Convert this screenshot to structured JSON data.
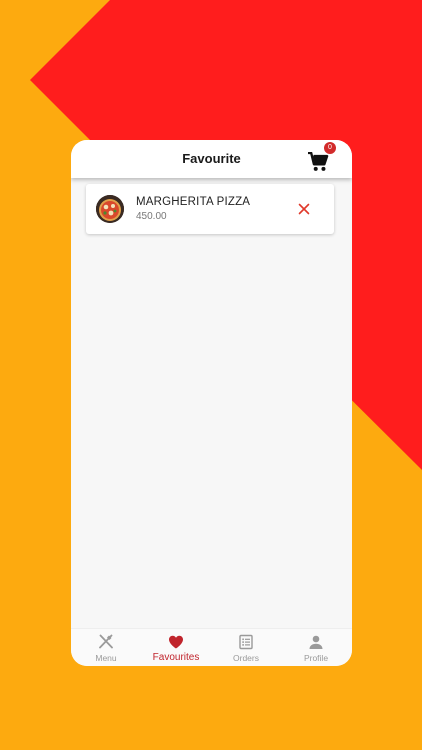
{
  "colors": {
    "background": "#FDAA0F",
    "accent_shape": "#FF1D1D",
    "active": "#C0242C",
    "inactive": "#9a9a9a"
  },
  "appbar": {
    "title": "Favourite",
    "cart_icon": "cart-icon",
    "cart_count": "0"
  },
  "favourites": [
    {
      "name": "MARGHERITA PIZZA",
      "price": "450.00",
      "image": "pizza-thumbnail",
      "remove_icon": "close-icon"
    }
  ],
  "bottom_nav": {
    "items": [
      {
        "label": "Menu",
        "icon": "fork-knife-icon",
        "active": false
      },
      {
        "label": "Favourites",
        "icon": "heart-icon",
        "active": true
      },
      {
        "label": "Orders",
        "icon": "list-icon",
        "active": false
      },
      {
        "label": "Profile",
        "icon": "person-icon",
        "active": false
      }
    ]
  }
}
